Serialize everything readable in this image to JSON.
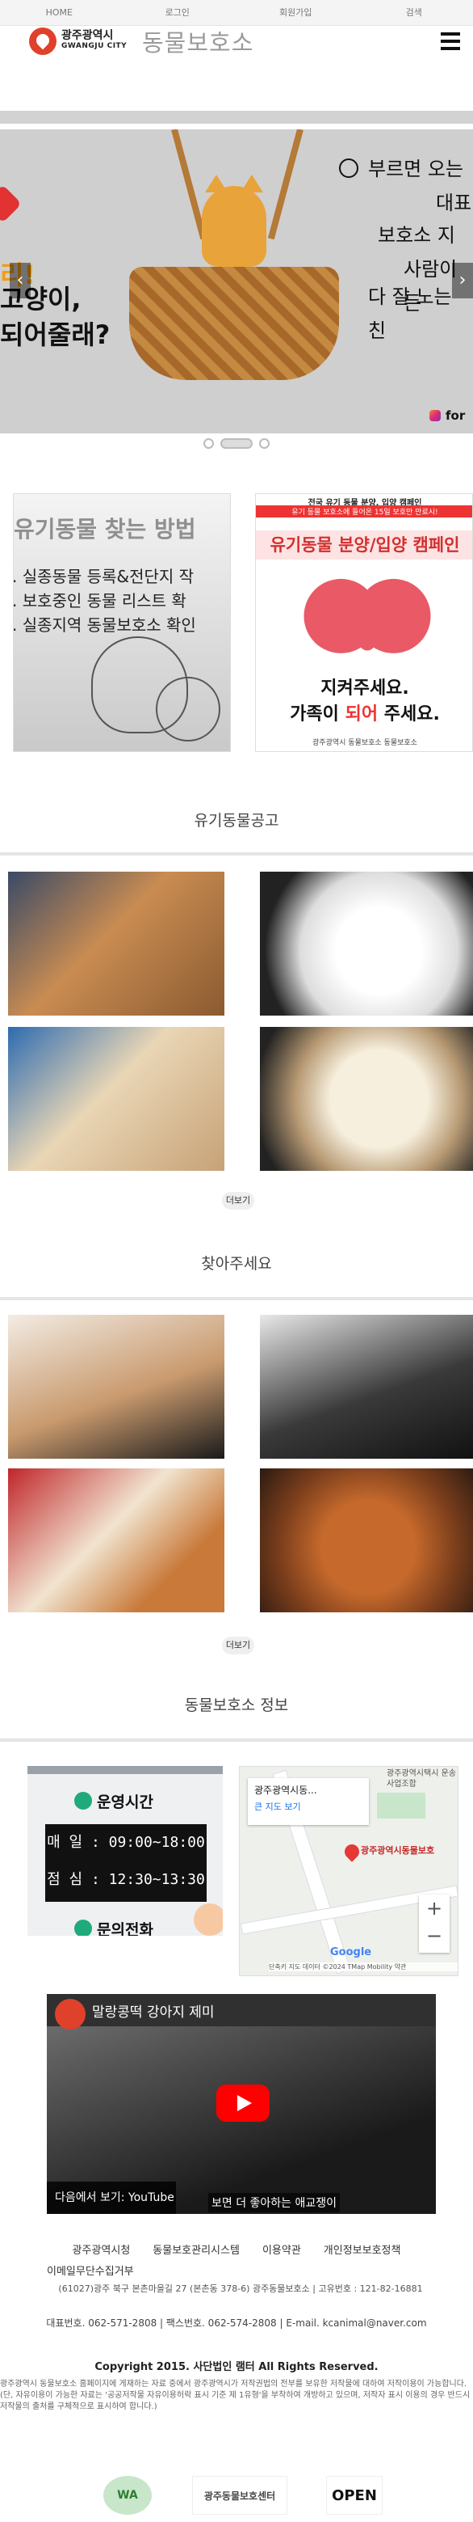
{
  "topnav": {
    "home": "HOME",
    "login": "로그인",
    "join": "회원가입",
    "search": "검색"
  },
  "header": {
    "logo_ko": "광주광역시",
    "logo_en": "GWANGJU CITY",
    "site_title": "동물보호소"
  },
  "slider": {
    "left_text": "고양이,",
    "left_text2": "되어줄래?",
    "right_lines": [
      "부르면 오는",
      "대표",
      "보호소 지",
      "사람이든",
      "다 잘 노는 친"
    ],
    "instagram": "for",
    "prev": "‹",
    "next": "›"
  },
  "banner_left": {
    "title": "유기동물 찾는 방법",
    "lines": [
      ". 실종동물 등록&전단지 작",
      ". 보호중인 동물 리스트 확",
      ". 실종지역 동물보호소 확인"
    ]
  },
  "banner_right": {
    "top": "전국 유기 동물 분양, 입양 캠페인",
    "red": "유기 동물 보호소에 들어온 15일 보호만 만료시!",
    "campaign": "유기동물 분양/입양 캠페인",
    "protect": "지켜주세요.",
    "family_pre": "가족이 ",
    "family_red": "되어",
    "family_post": " 주세요.",
    "foot": "광주광역시 동물보호소  동물보호소"
  },
  "sections": {
    "lost": "유기동물공고",
    "find": "찾아주세요",
    "info": "동물보호소 정보",
    "more": "더보기",
    "more2": "더보기"
  },
  "hours": {
    "title": "운영시간",
    "weekday": "매 일 : 09:00~18:00",
    "lunch": "점 심 : 12:30~13:30",
    "phone_title": "문의전화"
  },
  "map": {
    "place": "광주광역시동...",
    "larger": "큰 지도 보기",
    "pin_label": "광주광역시동물보호",
    "poi": "광주광역시택시\n운송사업조합",
    "footer": "단축키  지도 데이터 ©2024 TMap Mobility  약관",
    "zoom_in": "+",
    "zoom_out": "−",
    "google": "Google"
  },
  "video": {
    "title": "말랑콩떡 강아지 제미 ",
    "watch": "다음에서 보기: YouTube",
    "caption": "보면 더 좋아하는 애교쟁이"
  },
  "footer": {
    "links": [
      "광주광역시청",
      "동물보호관리시스템",
      "이용약관",
      "개인정보보호정책"
    ],
    "link5": "이메일무단수집거부",
    "address": "(61027)광주 북구 본촌마을길 27 (본촌동 378-6) 광주동물보호소  |  고유번호 : 121-82-16881",
    "tel": "대표번호. 062-571-2808  |  팩스번호. 062-574-2808  |  E-mail. kcanimal@naver.com",
    "copyright": "Copyright 2015. 사단법인 램터 All Rights Reserved.",
    "note": "광주광역시 동물보호소 홈페이지에 게재하는 자료 중에서 광주광역시가 저작권법의 전부를 보유한 저작물에 대하여 저작이용이 가능합니다. (단, 자유이용이 가능한 자료는 '공공저작물 자유이용허락 표시 기준 제 1유형'을 부착하여 개방하고 있으며, 저작자 표시 이용의 경우 반드시 저작물의 출처를 구체적으로 표시하여 합니다.)",
    "badges": [
      "WA",
      "광주동물보호센터",
      "OPEN"
    ]
  },
  "colors": {
    "accent": "#e0412b",
    "green": "#1faa7b"
  }
}
